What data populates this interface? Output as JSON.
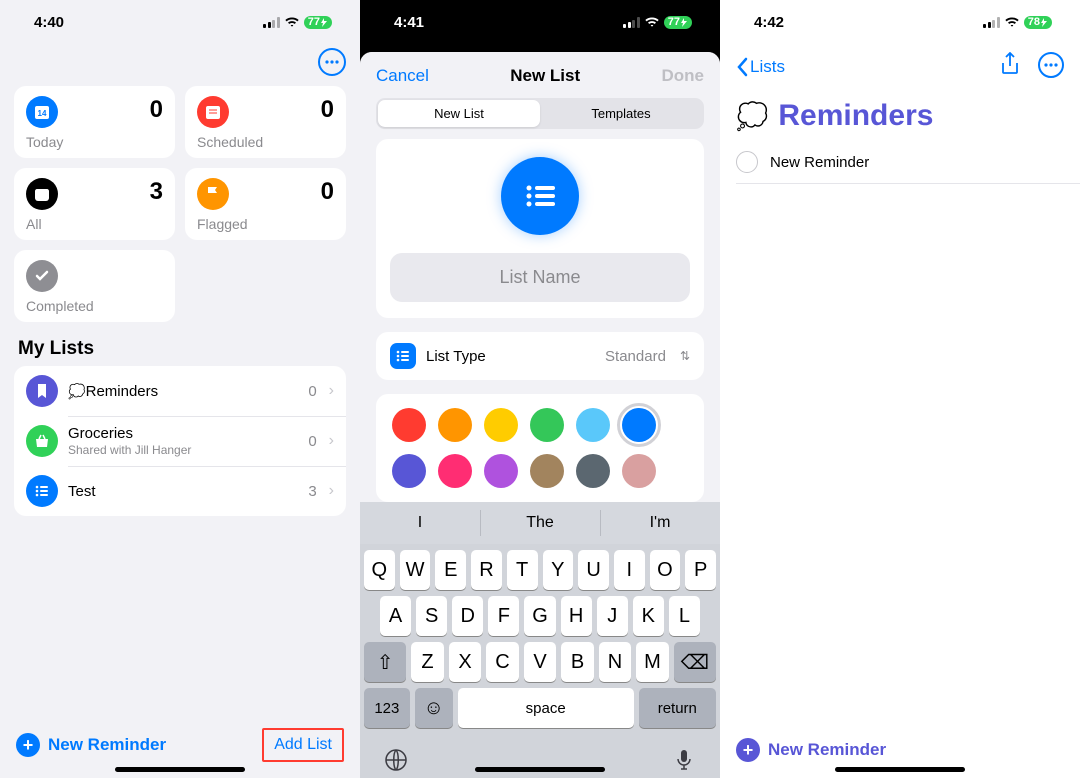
{
  "phone1": {
    "status": {
      "time": "4:40",
      "battery": "77"
    },
    "smart": [
      {
        "key": "today",
        "label": "Today",
        "count": 0,
        "color": "#007aff"
      },
      {
        "key": "scheduled",
        "label": "Scheduled",
        "count": 0,
        "color": "#ff3b30"
      },
      {
        "key": "all",
        "label": "All",
        "count": 3,
        "color": "#000000"
      },
      {
        "key": "flagged",
        "label": "Flagged",
        "count": 0,
        "color": "#ff9500"
      },
      {
        "key": "completed",
        "label": "Completed",
        "count": "",
        "color": "#8e8e93"
      }
    ],
    "lists_header": "My Lists",
    "lists": [
      {
        "name": "Reminders",
        "sub": "",
        "count": 0,
        "color": "#5856d6",
        "icon": "bookmark"
      },
      {
        "name": "Groceries",
        "sub": "Shared with Jill Hanger",
        "count": 0,
        "color": "#30d158",
        "icon": "basket"
      },
      {
        "name": "Test",
        "sub": "",
        "count": 3,
        "color": "#007aff",
        "icon": "list"
      }
    ],
    "new_reminder": "New Reminder",
    "add_list": "Add List"
  },
  "phone2": {
    "status": {
      "time": "4:41",
      "battery": "77"
    },
    "nav": {
      "cancel": "Cancel",
      "title": "New List",
      "done": "Done"
    },
    "segments": [
      "New List",
      "Templates"
    ],
    "list_name_placeholder": "List Name",
    "list_type": {
      "label": "List Type",
      "value": "Standard"
    },
    "colors": [
      "#ff3b30",
      "#ff9500",
      "#ffcc00",
      "#34c759",
      "#5ac8fa",
      "#007aff",
      "#5856d6",
      "#ff2d73",
      "#af52de",
      "#a2845e",
      "#5b6770",
      "#d9a0a0"
    ],
    "selected_color_index": 5,
    "suggestions": [
      "I",
      "The",
      "I'm"
    ],
    "space_label": "space",
    "return_label": "return",
    "num_label": "123"
  },
  "phone3": {
    "status": {
      "time": "4:42",
      "battery": "78"
    },
    "back": "Lists",
    "title": "Reminders",
    "item": "New Reminder",
    "new_reminder": "New Reminder"
  }
}
